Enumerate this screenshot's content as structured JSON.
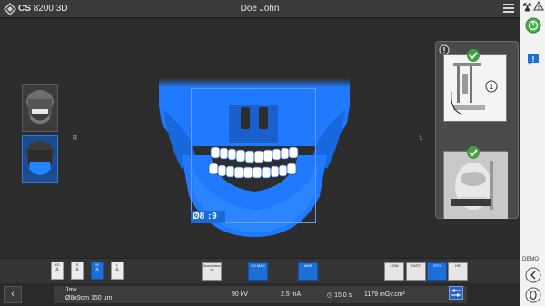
{
  "titlebar": {
    "app_title_bold": "CS",
    "app_title_rest": " 8200 3D",
    "patient_name": "Doe John"
  },
  "viewport": {
    "left_marker": "R",
    "right_marker": "L",
    "fov_badge": "Ø8 ↕9"
  },
  "toolbar": {
    "patient_sizes": [
      "XS",
      "S",
      "M",
      "L"
    ],
    "selected_patient_size": "M",
    "scout_view_label": "Scout view",
    "scout_view_sublabel": "2D",
    "cs_mar_label": "CS MAR",
    "anr_label": "ANR",
    "dose_low_label": "LOW",
    "dose_fast_label": "FAST",
    "dose_std_label": "STD",
    "dose_hr_label": "HR"
  },
  "status": {
    "program_name": "Jaw",
    "program_detail": "Ø8x9cm 150 µm",
    "kv": "90 kV",
    "ma": "2.5 mA",
    "time": "15.0 s",
    "dose": "1179 mGy.cm²"
  },
  "sidebar": {
    "demo_label": "DEMO"
  },
  "colors": {
    "accent": "#1e6ed8",
    "status_ok": "#4caf50"
  }
}
